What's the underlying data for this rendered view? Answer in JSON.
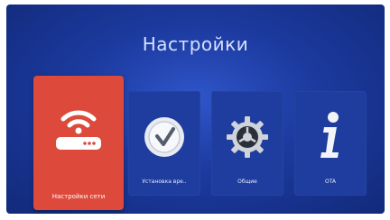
{
  "screen": {
    "title": "Настройки"
  },
  "tiles": [
    {
      "label": "Настройки сети",
      "icon": "router-wifi-icon",
      "selected": true
    },
    {
      "label": "Установка вре..",
      "icon": "clock-icon",
      "selected": false
    },
    {
      "label": "Общие",
      "icon": "gear-icon",
      "selected": false
    },
    {
      "label": "OTA",
      "icon": "info-icon",
      "selected": false
    }
  ],
  "colors": {
    "accent": "#dd4a3c",
    "tile": "#1e3d9e",
    "background": "#1c3a9f"
  }
}
